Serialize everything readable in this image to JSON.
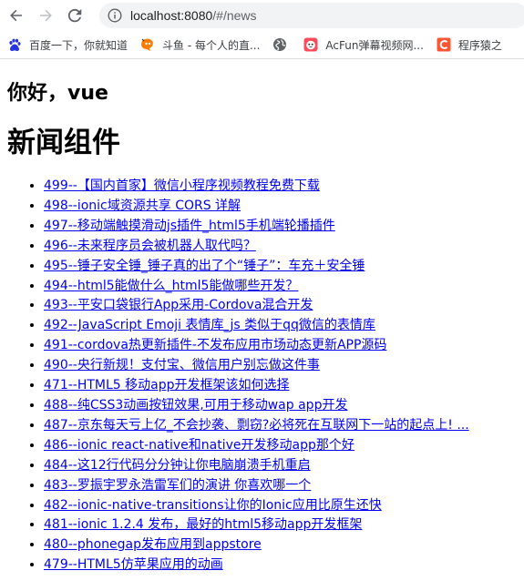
{
  "browser": {
    "url_host": "localhost:8080",
    "url_path": "/#/news",
    "bookmarks": [
      {
        "label": "百度一下，你就知道",
        "icon": "baidu-paw-icon",
        "color": "#2932e1"
      },
      {
        "label": "斗鱼 - 每个人的直...",
        "icon": "douyu-icon",
        "color": "#ff7a00"
      },
      {
        "label": "",
        "icon": "globe-icon",
        "color": "#5f6368"
      },
      {
        "label": "AcFun弹幕视频网...",
        "icon": "acfun-icon",
        "color": "#fd4c5c"
      },
      {
        "label": "程序猿之",
        "icon": "csdn-c-icon",
        "color": "#fc5531"
      }
    ]
  },
  "page": {
    "greeting": "你好，vue",
    "title": "新闻组件",
    "news": [
      "499--【国内首家】微信小程序视频教程免费下载",
      "498--ionic域资源共享 CORS 详解",
      "497--移动端触摸滑动js插件_html5手机端轮播插件",
      "496--未来程序员会被机器人取代吗？",
      "495--锤子安全锤_锤子真的出了个“锤子”：车充＋安全锤",
      "494--html5能做什么_html5能做哪些开发？",
      "493--平安口袋银行App采用-Cordova混合开发",
      "492--JavaScript Emoji 表情库_js 类似于qq微信的表情库",
      "491--cordova热更新插件-不发布应用市场动态更新APP源码",
      "490--央行新规！支付宝、微信用户别忘做这件事",
      "471--HTML5 移动app开发框架该如何选择",
      "488--纯CSS3动画按钮效果,可用于移动wap app开发",
      "487--京东每天亏上亿_不会抄袭、剽窃?必将死在互联网下一站的起点上! ...",
      "486--ionic react-native和native开发移动app那个好",
      "484--这12行代码分分钟让你电脑崩溃手机重启",
      "483--罗振宇罗永浩雷军们的演讲 你喜欢哪一个",
      "482--ionic-native-transitions让你的Ionic应用比原生还快",
      "481--ionic 1.2.4 发布，最好的html5移动app开发框架",
      "480--phonegap发布应用到appstore",
      "479--HTML5仿苹果应用的动画"
    ]
  },
  "colors": {
    "link": "#0000ee",
    "omnibox_bg": "#f1f3f4"
  }
}
